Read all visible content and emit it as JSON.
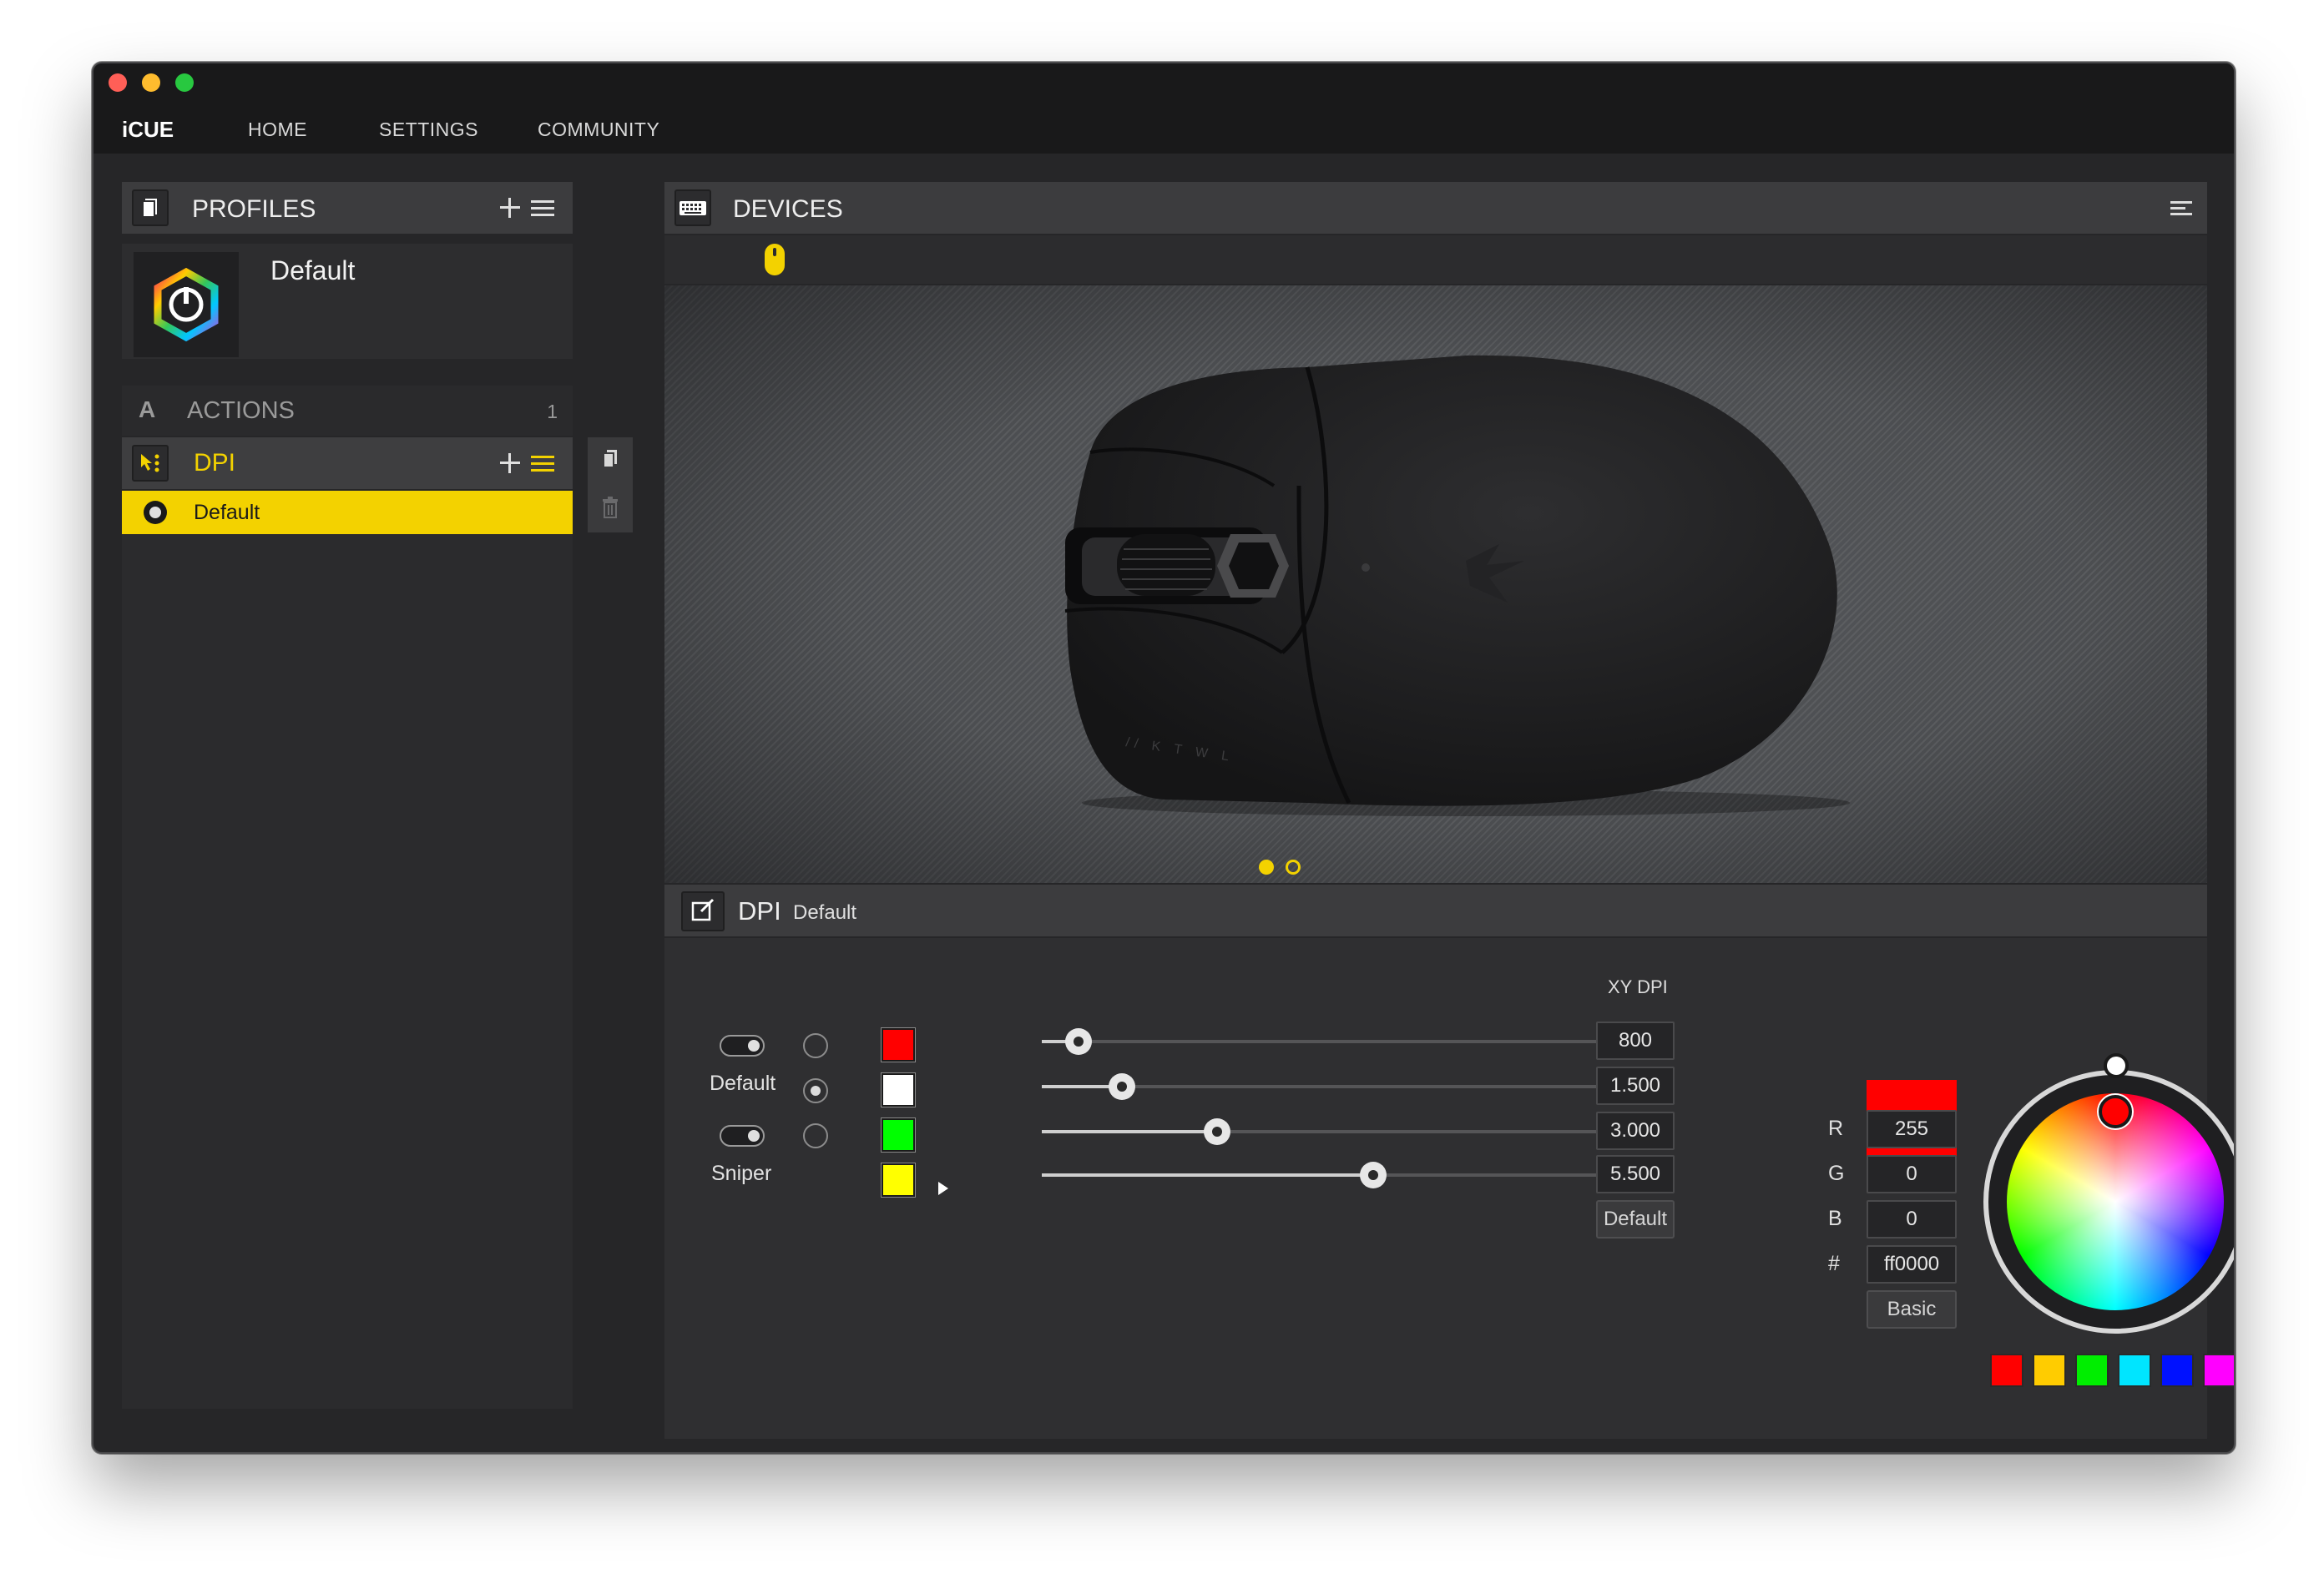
{
  "app": {
    "logo": "iCUE"
  },
  "nav": {
    "home": "HOME",
    "settings": "SETTINGS",
    "community": "COMMUNITY"
  },
  "profiles": {
    "title": "PROFILES",
    "items": [
      {
        "name": "Default"
      }
    ]
  },
  "actions": {
    "title": "ACTIONS",
    "count": "1"
  },
  "dpi_list": {
    "label": "DPI",
    "selected_item": "Default"
  },
  "devices": {
    "title": "DEVICES",
    "mouse_print": "// K T W L",
    "page_count": 2,
    "active_page": 1
  },
  "dpi_editor": {
    "title": "DPI",
    "subtitle": "Default",
    "xy_label": "XY DPI",
    "stages": [
      {
        "label": "",
        "toggle": true,
        "radio": false,
        "color": "#ff0000",
        "value": "800",
        "percent": 0.06
      },
      {
        "label": "Default",
        "toggle": false,
        "radio": true,
        "color": "#ffffff",
        "value": "1.500",
        "percent": 0.13
      },
      {
        "label": "",
        "toggle": true,
        "radio": false,
        "color": "#00ff00",
        "value": "3.000",
        "percent": 0.285,
        "playing": true
      },
      {
        "label": "Sniper",
        "toggle": false,
        "radio": false,
        "color": "#ffff00",
        "value": "5.500",
        "percent": 0.54
      }
    ],
    "default_button": "Default"
  },
  "color": {
    "r_label": "R",
    "g_label": "G",
    "b_label": "B",
    "hex_label": "#",
    "r": "255",
    "g": "0",
    "b": "0",
    "hex": "ff0000",
    "preview": "#ff0000",
    "basic_button": "Basic",
    "palette": [
      "#ff0000",
      "#ffcc00",
      "#00ee00",
      "#00e5ff",
      "#0011ff",
      "#ff00ff",
      "#ffffff"
    ]
  },
  "accent": "#f3d200"
}
